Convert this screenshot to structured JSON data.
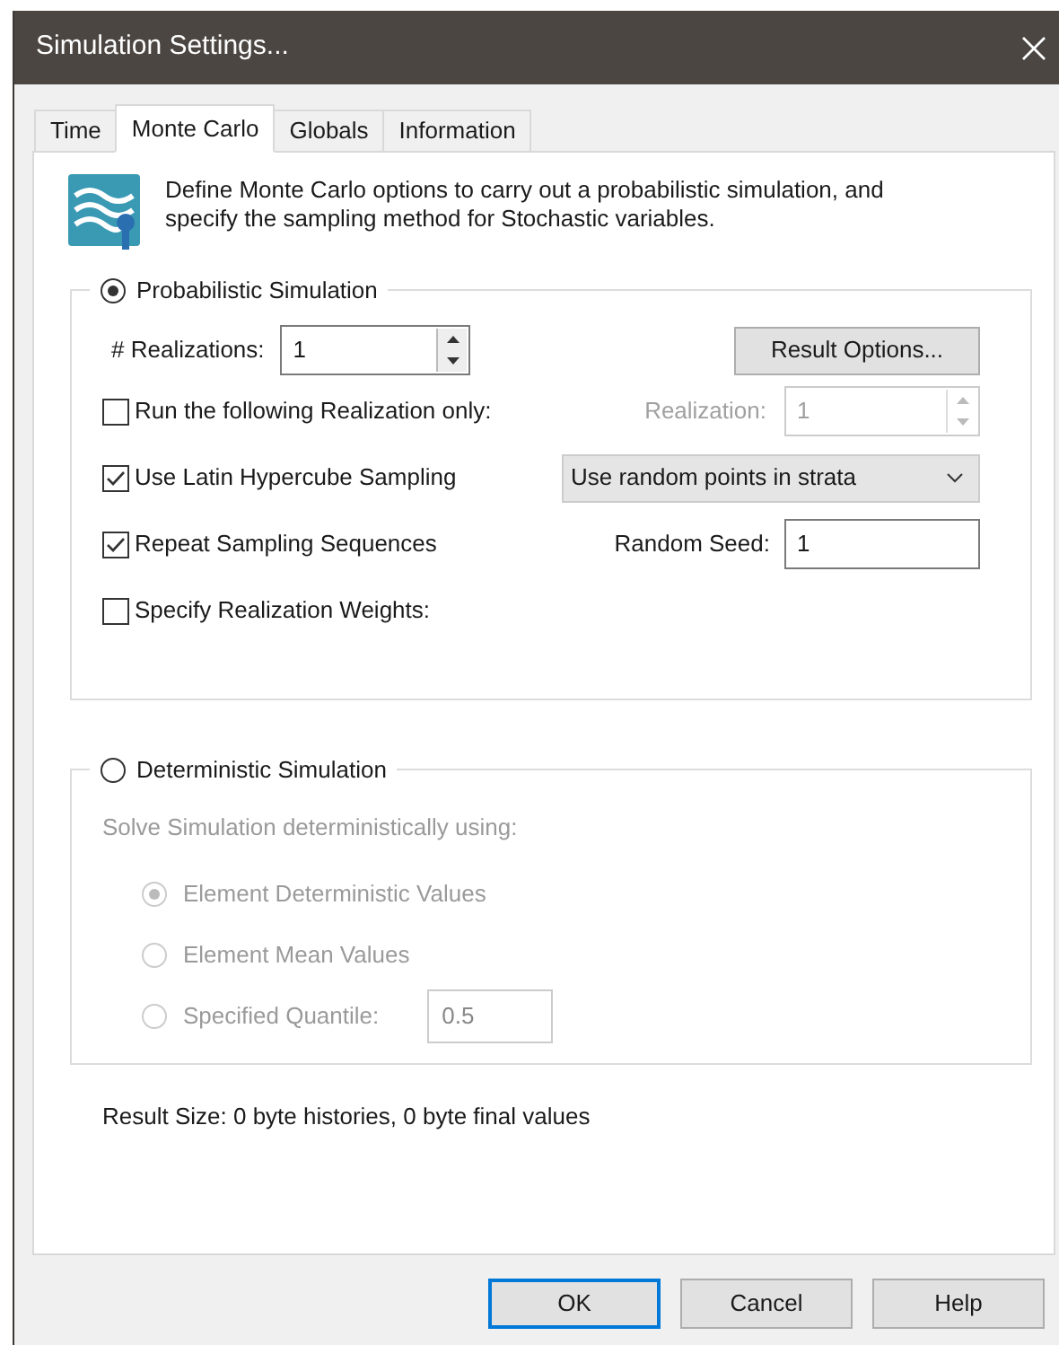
{
  "window": {
    "title": "Simulation Settings..."
  },
  "tabs": [
    {
      "label": "Time",
      "selected": false
    },
    {
      "label": "Monte Carlo",
      "selected": true
    },
    {
      "label": "Globals",
      "selected": false
    },
    {
      "label": "Information",
      "selected": false
    }
  ],
  "intro": "Define Monte Carlo options to carry out a probabilistic simulation, and specify the sampling method for Stochastic variables.",
  "probabilistic": {
    "label": "Probabilistic Simulation",
    "selected": true,
    "realizations": {
      "label": "# Realizations:",
      "value": "1"
    },
    "result_options_button": "Result Options...",
    "options": [
      {
        "label": "Run the following Realization only:",
        "checked": false
      },
      {
        "label": "Use Latin Hypercube Sampling",
        "checked": true
      },
      {
        "label": "Repeat Sampling Sequences",
        "checked": true
      },
      {
        "label": "Specify Realization Weights:",
        "checked": false
      }
    ],
    "realization": {
      "label": "Realization:",
      "value": "1",
      "disabled": true
    },
    "sampling_method": "Use random points in strata",
    "random_seed": {
      "label": "Random Seed:",
      "value": "1"
    }
  },
  "deterministic": {
    "label": "Deterministic Simulation",
    "selected": false,
    "disabled": true,
    "prompt": "Solve Simulation deterministically using:",
    "methods": [
      {
        "label": "Element Deterministic Values",
        "selected": true
      },
      {
        "label": "Element Mean Values",
        "selected": false
      },
      {
        "label": "Specified Quantile:",
        "selected": false
      }
    ],
    "quantile": "0.5"
  },
  "result_size": "Result Size: 0 byte histories, 0 byte final values",
  "buttons": [
    {
      "label": "OK",
      "default": true
    },
    {
      "label": "Cancel",
      "default": false
    },
    {
      "label": "Help",
      "default": false
    }
  ]
}
